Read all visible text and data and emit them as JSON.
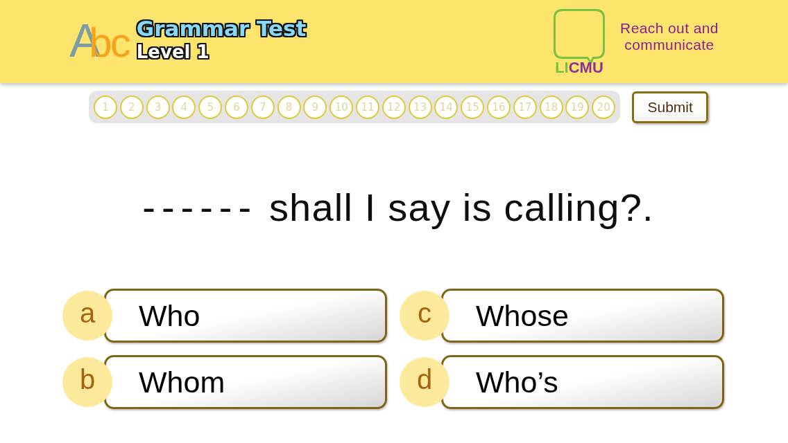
{
  "header": {
    "logo": {
      "lead": "A",
      "tail": "bc"
    },
    "title": "Grammar Test",
    "level": "Level 1",
    "brand": {
      "lead": "LI",
      "tail": "CMU"
    },
    "tagline": "Reach out and communicate"
  },
  "question_nav": {
    "numbers": [
      "1",
      "2",
      "3",
      "4",
      "5",
      "6",
      "7",
      "8",
      "9",
      "10",
      "11",
      "12",
      "13",
      "14",
      "15",
      "16",
      "17",
      "18",
      "19",
      "20"
    ]
  },
  "submit_button": {
    "label": "Submit"
  },
  "question": {
    "blank": "------",
    "text": "shall I say is calling?."
  },
  "options": [
    {
      "letter": "a",
      "text": "Who"
    },
    {
      "letter": "b",
      "text": "Whom"
    },
    {
      "letter": "c",
      "text": "Whose"
    },
    {
      "letter": "d",
      "text": "Who’s"
    }
  ]
}
